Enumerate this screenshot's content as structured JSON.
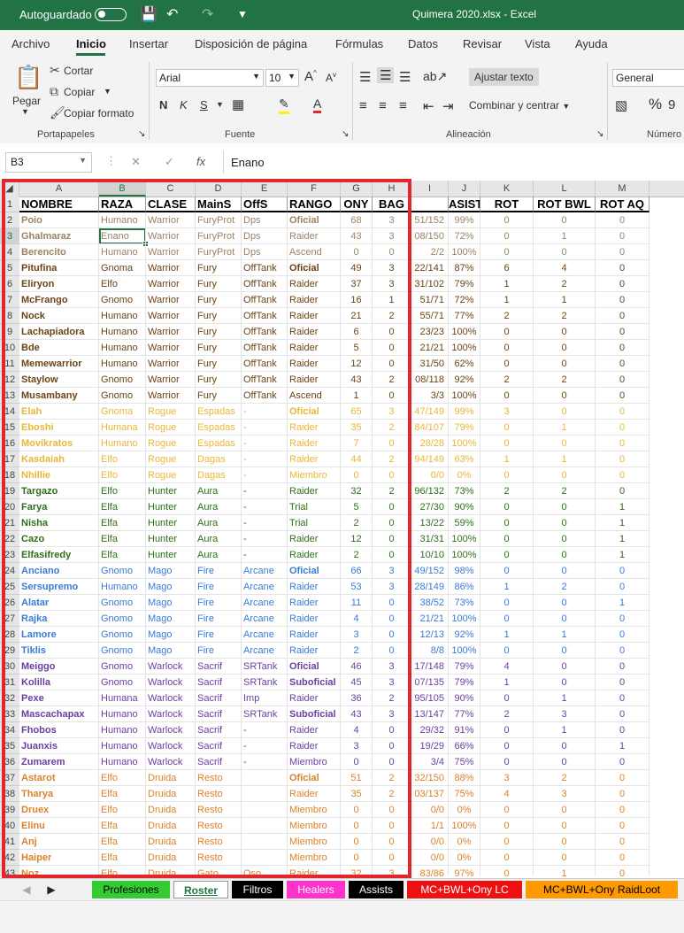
{
  "titlebar": {
    "autosave_label": "Autoguardado",
    "filename": "Quimera 2020.xlsx - Excel"
  },
  "menu": [
    "Archivo",
    "Inicio",
    "Insertar",
    "Disposición de página",
    "Fórmulas",
    "Datos",
    "Revisar",
    "Vista",
    "Ayuda"
  ],
  "ribbon": {
    "paste": "Pegar",
    "cut": "Cortar",
    "copy": "Copiar",
    "format_painter": "Copiar formato",
    "clipboard_group": "Portapapeles",
    "font_name": "Arial",
    "font_size": "10",
    "font_group": "Fuente",
    "wrap_text": "Ajustar texto",
    "merge_center": "Combinar y centrar",
    "alignment_group": "Alineación",
    "number_format": "General",
    "number_group": "Número"
  },
  "formula_bar": {
    "cell_ref": "B3",
    "content": "Enano"
  },
  "colors": {
    "brand": "#217346",
    "highlight_border": "#e3262c"
  },
  "columns": [
    "A",
    "B",
    "C",
    "D",
    "E",
    "F",
    "G",
    "H",
    "I",
    "J",
    "K",
    "L",
    "M"
  ],
  "header_row": [
    "NOMBRE",
    "RAZA",
    "CLASE",
    "MainS",
    "OffS",
    "RANGO",
    "ONY",
    "BAG",
    "",
    "ASISTS",
    "ROT",
    "ROT BWL",
    "ROT AQ"
  ],
  "class_colors": {
    "warrior_dim": "#9c8266",
    "warrior": "#6b4418",
    "rogue": "#e8b73a",
    "hunter": "#2e6e1c",
    "mage": "#3a7bd5",
    "warlock": "#6a3fa0",
    "druid": "#d9822b"
  },
  "rows": [
    {
      "n": "2",
      "cls": "warrior_dim",
      "c": [
        "Poio",
        "Humano",
        "Warrior",
        "FuryProt",
        "Dps",
        "Oficial",
        "68",
        "3",
        "51/152",
        "99%",
        "0",
        "0",
        "0"
      ],
      "boldF": true
    },
    {
      "n": "3",
      "cls": "warrior_dim",
      "c": [
        "Ghalmaraz",
        "Enano",
        "Warrior",
        "FuryProt",
        "Dps",
        "Raider",
        "43",
        "3",
        "08/150",
        "72%",
        "0",
        "1",
        "0"
      ]
    },
    {
      "n": "4",
      "cls": "warrior_dim",
      "c": [
        "Berencito",
        "Humano",
        "Warrior",
        "FuryProt",
        "Dps",
        "Ascend",
        "0",
        "0",
        "2/2",
        "100%",
        "0",
        "0",
        "0"
      ]
    },
    {
      "n": "5",
      "cls": "warrior",
      "c": [
        "Pitufina",
        "Gnoma",
        "Warrior",
        "Fury",
        "OffTank",
        "Oficial",
        "49",
        "3",
        "22/141",
        "87%",
        "6",
        "4",
        "0"
      ],
      "boldF": true
    },
    {
      "n": "6",
      "cls": "warrior",
      "c": [
        "Eliryon",
        "Elfo",
        "Warrior",
        "Fury",
        "OffTank",
        "Raider",
        "37",
        "3",
        "31/102",
        "79%",
        "1",
        "2",
        "0"
      ]
    },
    {
      "n": "7",
      "cls": "warrior",
      "c": [
        "McFrango",
        "Gnomo",
        "Warrior",
        "Fury",
        "OffTank",
        "Raider",
        "16",
        "1",
        "51/71",
        "72%",
        "1",
        "1",
        "0"
      ]
    },
    {
      "n": "8",
      "cls": "warrior",
      "c": [
        "Nock",
        "Humano",
        "Warrior",
        "Fury",
        "OffTank",
        "Raider",
        "21",
        "2",
        "55/71",
        "77%",
        "2",
        "2",
        "0"
      ]
    },
    {
      "n": "9",
      "cls": "warrior",
      "c": [
        "Lachapiadora",
        "Humano",
        "Warrior",
        "Fury",
        "OffTank",
        "Raider",
        "6",
        "0",
        "23/23",
        "100%",
        "0",
        "0",
        "0"
      ]
    },
    {
      "n": "10",
      "cls": "warrior",
      "c": [
        "Bde",
        "Humano",
        "Warrior",
        "Fury",
        "OffTank",
        "Raider",
        "5",
        "0",
        "21/21",
        "100%",
        "0",
        "0",
        "0"
      ]
    },
    {
      "n": "11",
      "cls": "warrior",
      "c": [
        "Memewarrior",
        "Humano",
        "Warrior",
        "Fury",
        "OffTank",
        "Raider",
        "12",
        "0",
        "31/50",
        "62%",
        "0",
        "0",
        "0"
      ]
    },
    {
      "n": "12",
      "cls": "warrior",
      "c": [
        "Staylow",
        "Gnomo",
        "Warrior",
        "Fury",
        "OffTank",
        "Raider",
        "43",
        "2",
        "08/118",
        "92%",
        "2",
        "2",
        "0"
      ]
    },
    {
      "n": "13",
      "cls": "warrior",
      "c": [
        "Musambany",
        "Gnomo",
        "Warrior",
        "Fury",
        "OffTank",
        "Ascend",
        "1",
        "0",
        "3/3",
        "100%",
        "0",
        "0",
        "0"
      ]
    },
    {
      "n": "14",
      "cls": "rogue",
      "c": [
        "Elah",
        "Gnoma",
        "Rogue",
        "Espadas",
        "-",
        "Oficial",
        "65",
        "3",
        "47/149",
        "99%",
        "3",
        "0",
        "0"
      ],
      "boldF": true
    },
    {
      "n": "15",
      "cls": "rogue",
      "c": [
        "Eboshi",
        "Humana",
        "Rogue",
        "Espadas",
        "-",
        "Raider",
        "35",
        "2",
        "84/107",
        "79%",
        "0",
        "1",
        "0"
      ]
    },
    {
      "n": "16",
      "cls": "rogue",
      "c": [
        "Movikratos",
        "Humano",
        "Rogue",
        "Espadas",
        "-",
        "Raider",
        "7",
        "0",
        "28/28",
        "100%",
        "0",
        "0",
        "0"
      ]
    },
    {
      "n": "17",
      "cls": "rogue",
      "c": [
        "Kasdaiah",
        "Elfo",
        "Rogue",
        "Dagas",
        "-",
        "Raider",
        "44",
        "2",
        "94/149",
        "63%",
        "1",
        "1",
        "0"
      ]
    },
    {
      "n": "18",
      "cls": "rogue",
      "c": [
        "Nhillie",
        "Elfo",
        "Rogue",
        "Dagas",
        "-",
        "Miembro",
        "0",
        "0",
        "0/0",
        "0%",
        "0",
        "0",
        "0"
      ]
    },
    {
      "n": "19",
      "cls": "hunter",
      "c": [
        "Targazo",
        "Elfo",
        "Hunter",
        "Aura",
        "-",
        "Raider",
        "32",
        "2",
        "96/132",
        "73%",
        "2",
        "2",
        "0"
      ]
    },
    {
      "n": "20",
      "cls": "hunter",
      "c": [
        "Farya",
        "Elfa",
        "Hunter",
        "Aura",
        "-",
        "Trial",
        "5",
        "0",
        "27/30",
        "90%",
        "0",
        "0",
        "1"
      ]
    },
    {
      "n": "21",
      "cls": "hunter",
      "c": [
        "Nisha",
        "Elfa",
        "Hunter",
        "Aura",
        "-",
        "Trial",
        "2",
        "0",
        "13/22",
        "59%",
        "0",
        "0",
        "1"
      ]
    },
    {
      "n": "22",
      "cls": "hunter",
      "c": [
        "Cazo",
        "Elfa",
        "Hunter",
        "Aura",
        "-",
        "Raider",
        "12",
        "0",
        "31/31",
        "100%",
        "0",
        "0",
        "1"
      ]
    },
    {
      "n": "23",
      "cls": "hunter",
      "c": [
        "Elfasifredy",
        "Elfa",
        "Hunter",
        "Aura",
        "-",
        "Raider",
        "2",
        "0",
        "10/10",
        "100%",
        "0",
        "0",
        "1"
      ]
    },
    {
      "n": "24",
      "cls": "mage",
      "c": [
        "Anciano",
        "Gnomo",
        "Mago",
        "Fire",
        "Arcane",
        "Oficial",
        "66",
        "3",
        "49/152",
        "98%",
        "0",
        "0",
        "0"
      ],
      "boldF": true
    },
    {
      "n": "25",
      "cls": "mage",
      "c": [
        "Sersupremo",
        "Humano",
        "Mago",
        "Fire",
        "Arcane",
        "Raider",
        "53",
        "3",
        "28/149",
        "86%",
        "1",
        "2",
        "0"
      ]
    },
    {
      "n": "26",
      "cls": "mage",
      "c": [
        "Alatar",
        "Gnomo",
        "Mago",
        "Fire",
        "Arcane",
        "Raider",
        "11",
        "0",
        "38/52",
        "73%",
        "0",
        "0",
        "1"
      ]
    },
    {
      "n": "27",
      "cls": "mage",
      "c": [
        "Rajka",
        "Gnomo",
        "Mago",
        "Fire",
        "Arcane",
        "Raider",
        "4",
        "0",
        "21/21",
        "100%",
        "0",
        "0",
        "0"
      ]
    },
    {
      "n": "28",
      "cls": "mage",
      "c": [
        "Lamore",
        "Gnomo",
        "Mago",
        "Fire",
        "Arcane",
        "Raider",
        "3",
        "0",
        "12/13",
        "92%",
        "1",
        "1",
        "0"
      ]
    },
    {
      "n": "29",
      "cls": "mage",
      "c": [
        "Tiklis",
        "Gnomo",
        "Mago",
        "Fire",
        "Arcane",
        "Raider",
        "2",
        "0",
        "8/8",
        "100%",
        "0",
        "0",
        "0"
      ]
    },
    {
      "n": "30",
      "cls": "warlock",
      "c": [
        "Meiggo",
        "Gnomo",
        "Warlock",
        "Sacrif",
        "SRTank",
        "Oficial",
        "46",
        "3",
        "17/148",
        "79%",
        "4",
        "0",
        "0"
      ],
      "boldF": true
    },
    {
      "n": "31",
      "cls": "warlock",
      "c": [
        "Kolilla",
        "Gnomo",
        "Warlock",
        "Sacrif",
        "SRTank",
        "Suboficial",
        "45",
        "3",
        "07/135",
        "79%",
        "1",
        "0",
        "0"
      ],
      "boldF": true
    },
    {
      "n": "32",
      "cls": "warlock",
      "c": [
        "Pexe",
        "Humana",
        "Warlock",
        "Sacrif",
        "Imp",
        "Raider",
        "36",
        "2",
        "95/105",
        "90%",
        "0",
        "1",
        "0"
      ]
    },
    {
      "n": "33",
      "cls": "warlock",
      "c": [
        "Mascachapax",
        "Humano",
        "Warlock",
        "Sacrif",
        "SRTank",
        "Suboficial",
        "43",
        "3",
        "13/147",
        "77%",
        "2",
        "3",
        "0"
      ],
      "boldF": true
    },
    {
      "n": "34",
      "cls": "warlock",
      "c": [
        "Fhobos",
        "Humano",
        "Warlock",
        "Sacrif",
        "-",
        "Raider",
        "4",
        "0",
        "29/32",
        "91%",
        "0",
        "1",
        "0"
      ]
    },
    {
      "n": "35",
      "cls": "warlock",
      "c": [
        "Juanxis",
        "Humano",
        "Warlock",
        "Sacrif",
        "-",
        "Raider",
        "3",
        "0",
        "19/29",
        "66%",
        "0",
        "0",
        "1"
      ]
    },
    {
      "n": "36",
      "cls": "warlock",
      "c": [
        "Zumarem",
        "Humano",
        "Warlock",
        "Sacrif",
        "-",
        "Miembro",
        "0",
        "0",
        "3/4",
        "75%",
        "0",
        "0",
        "0"
      ]
    },
    {
      "n": "37",
      "cls": "druid",
      "c": [
        "Astarot",
        "Elfo",
        "Druida",
        "Resto",
        "",
        "Oficial",
        "51",
        "2",
        "32/150",
        "88%",
        "3",
        "2",
        "0"
      ],
      "boldF": true
    },
    {
      "n": "38",
      "cls": "druid",
      "c": [
        "Tharya",
        "Elfa",
        "Druida",
        "Resto",
        "",
        "Raider",
        "35",
        "2",
        "03/137",
        "75%",
        "4",
        "3",
        "0"
      ]
    },
    {
      "n": "39",
      "cls": "druid",
      "c": [
        "Druex",
        "Elfo",
        "Druida",
        "Resto",
        "",
        "Miembro",
        "0",
        "0",
        "0/0",
        "0%",
        "0",
        "0",
        "0"
      ]
    },
    {
      "n": "40",
      "cls": "druid",
      "c": [
        "Elinu",
        "Elfa",
        "Druida",
        "Resto",
        "",
        "Miembro",
        "0",
        "0",
        "1/1",
        "100%",
        "0",
        "0",
        "0"
      ]
    },
    {
      "n": "41",
      "cls": "druid",
      "c": [
        "Anj",
        "Elfa",
        "Druida",
        "Resto",
        "",
        "Miembro",
        "0",
        "0",
        "0/0",
        "0%",
        "0",
        "0",
        "0"
      ]
    },
    {
      "n": "42",
      "cls": "druid",
      "c": [
        "Haiper",
        "Elfa",
        "Druida",
        "Resto",
        "",
        "Miembro",
        "0",
        "0",
        "0/0",
        "0%",
        "0",
        "0",
        "0"
      ]
    },
    {
      "n": "43",
      "cls": "druid",
      "c": [
        "Noz",
        "Elfo",
        "Druida",
        "Gato",
        "Oso",
        "Raider",
        "32",
        "3",
        "83/86",
        "97%",
        "0",
        "1",
        "0"
      ]
    }
  ],
  "sheet_tabs": [
    {
      "label": "Profesiones",
      "bg": "#33cc33",
      "fg": "#000000"
    },
    {
      "label": "Roster",
      "bg": "#ffffff",
      "fg": "#217346",
      "active": true
    },
    {
      "label": "Filtros",
      "bg": "#000000",
      "fg": "#ffffff"
    },
    {
      "label": "Healers",
      "bg": "#ff33cc",
      "fg": "#ffffff"
    },
    {
      "label": "Assists",
      "bg": "#000000",
      "fg": "#ffffff"
    },
    {
      "label": "MC+BWL+Ony LC",
      "bg": "#ee1111",
      "fg": "#ffffff"
    },
    {
      "label": "MC+BWL+Ony RaidLoot",
      "bg": "#ff9900",
      "fg": "#000000"
    }
  ]
}
